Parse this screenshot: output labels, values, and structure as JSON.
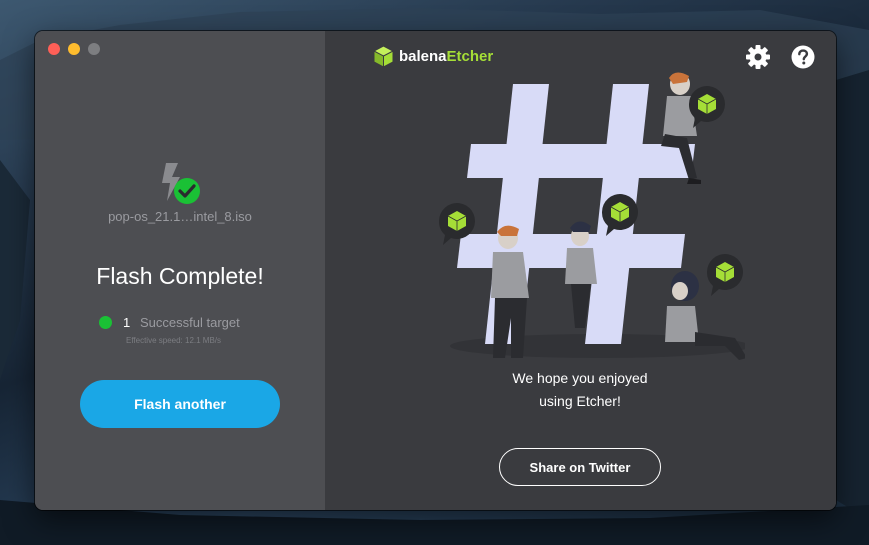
{
  "window": {
    "controls": {
      "close_color": "#fe5f57",
      "minimize_color": "#febc2e",
      "maximize_color": "#7d7e81"
    }
  },
  "left": {
    "image_name": "pop-os_21.1…intel_8.iso",
    "title": "Flash Complete!",
    "success_count": "1",
    "success_label": "Successful target",
    "speed": "Effective speed: 12.1 MB/s",
    "flash_another_label": "Flash another"
  },
  "header": {
    "brand_first": "balena",
    "brand_second": "Etcher",
    "icons": [
      "gear-icon",
      "help-icon"
    ]
  },
  "right": {
    "message_line1": "We hope you enjoyed",
    "message_line2": "using Etcher!",
    "share_label": "Share on Twitter"
  },
  "colors": {
    "accent_blue": "#1aa7e6",
    "success_green": "#1ac135",
    "brand_green": "#a5de37",
    "panel_left": "#4d4e52",
    "panel_right": "#3a3b3f"
  }
}
